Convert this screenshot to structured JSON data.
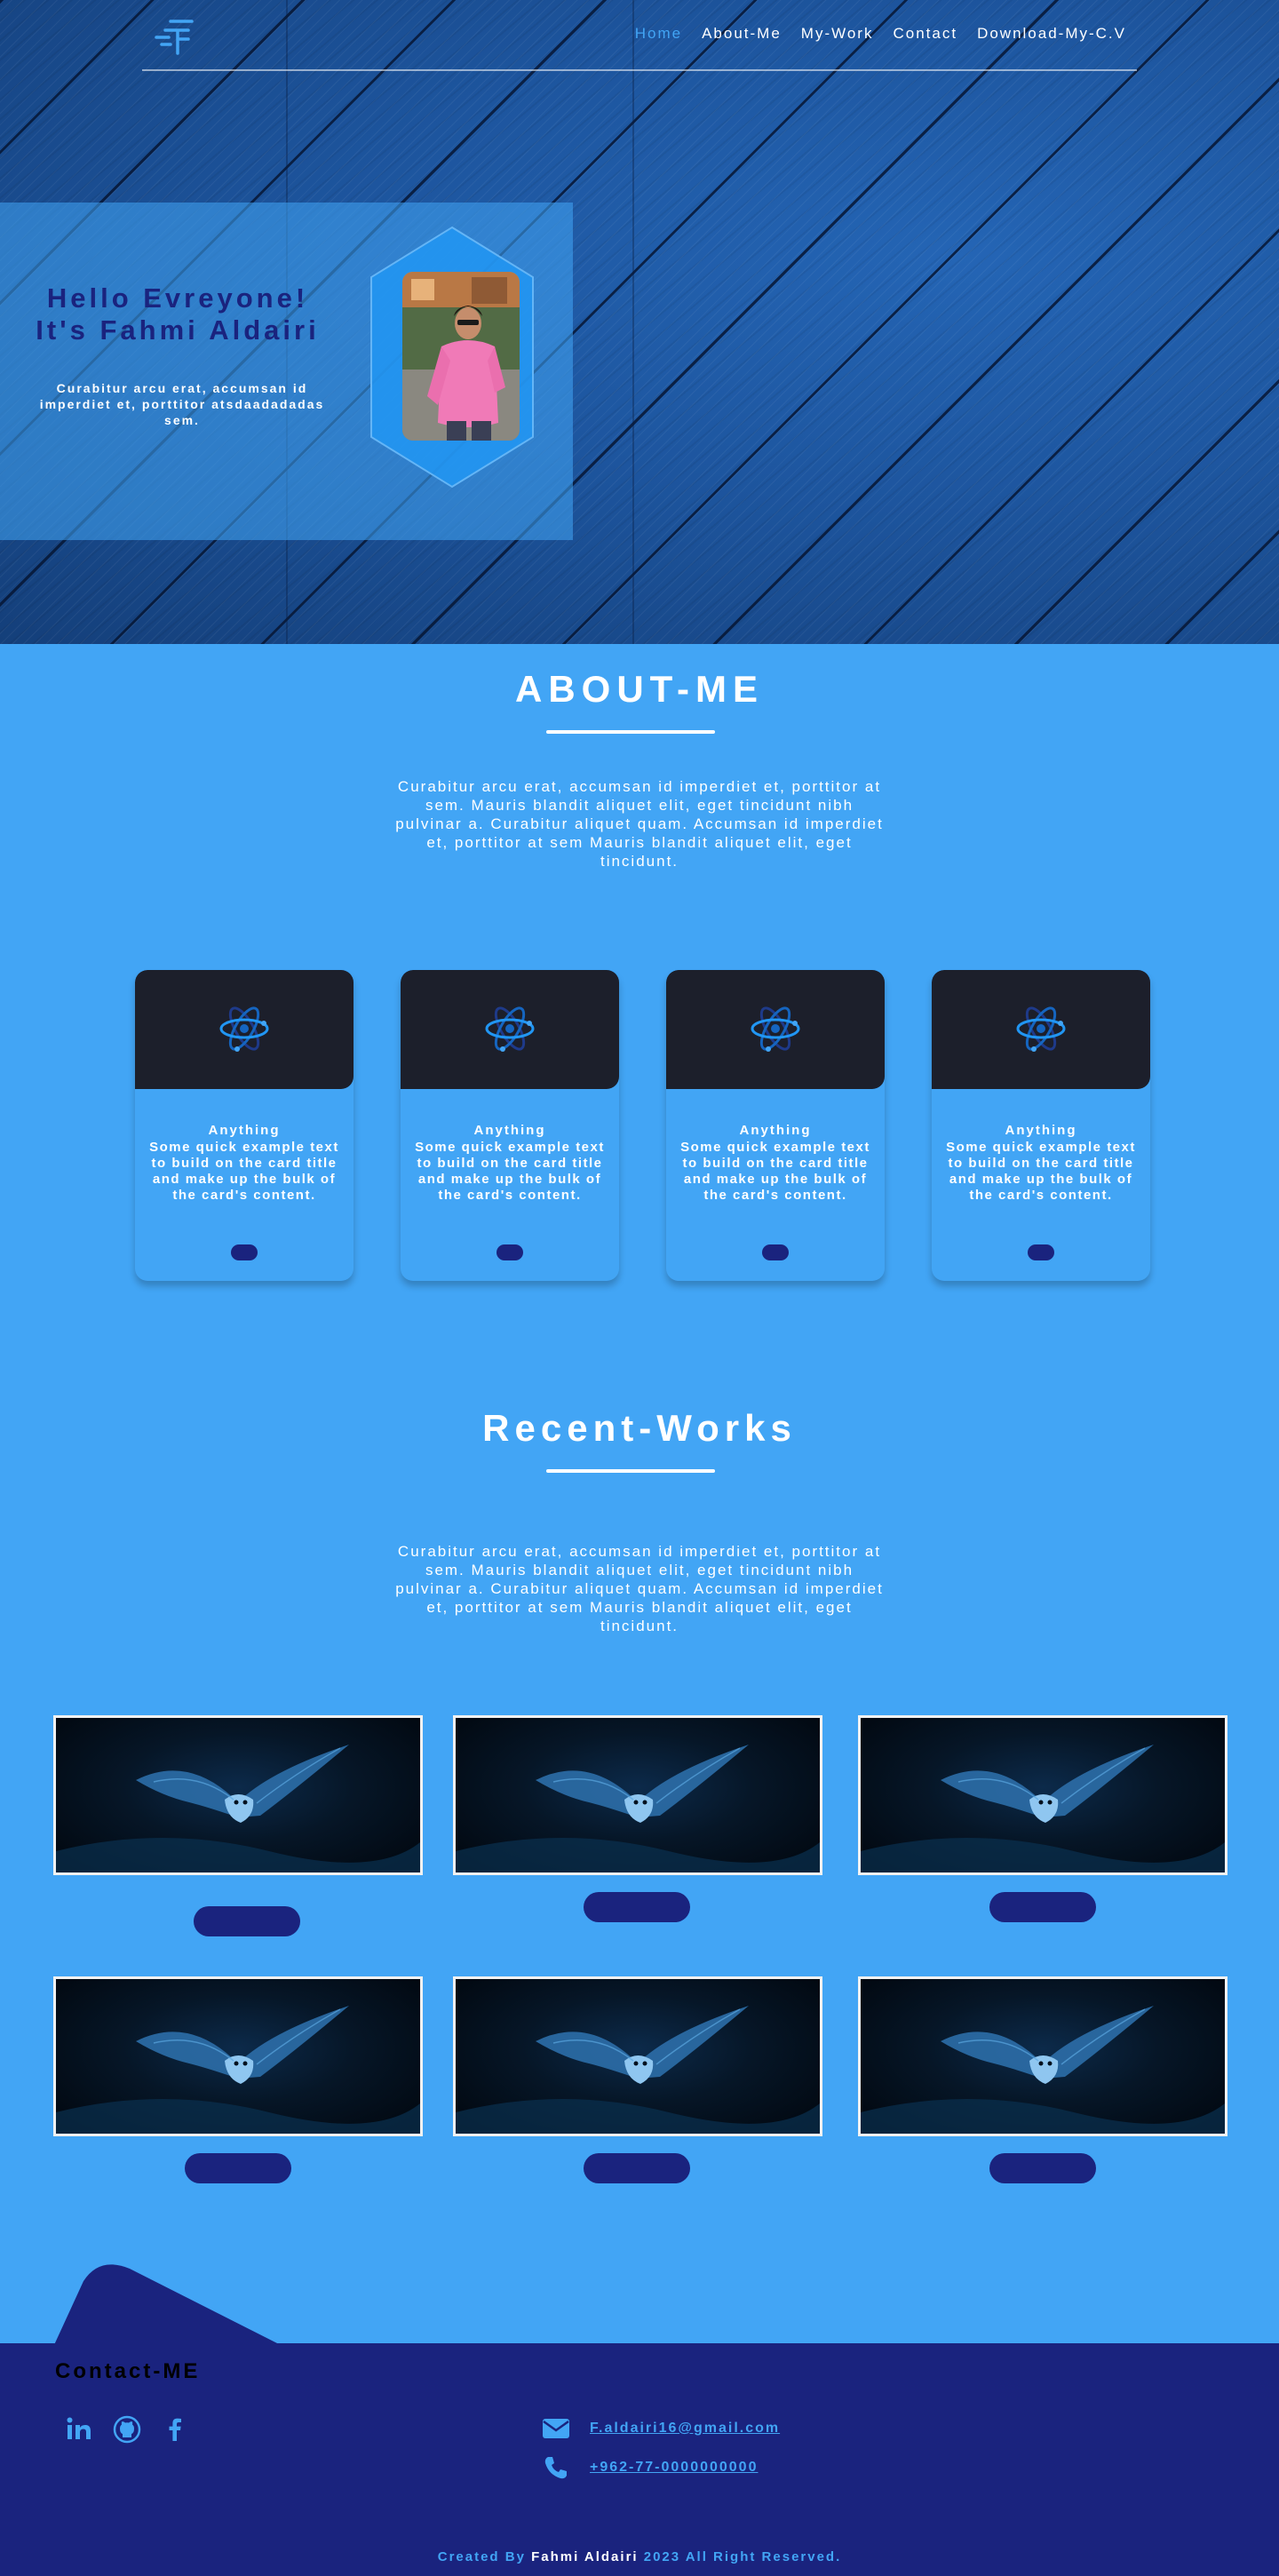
{
  "nav": {
    "logo_icon": "fahmi-logo-icon",
    "links": [
      "Home",
      "About-Me",
      "My-Work",
      "Contact",
      "Download-My-C.V"
    ],
    "active": "Home"
  },
  "hero": {
    "heading_line1": "Hello Evreyone!",
    "heading_line2": "It's Fahmi Aldairi",
    "subtitle": "Curabitur arcu erat, accumsan id imperdiet et, porttitor atsdaadadadas sem.",
    "portrait_icon": "profile-photo"
  },
  "about": {
    "title": "ABOUT-ME",
    "description": "Curabitur arcu erat, accumsan id imperdiet et, porttitor at sem. Mauris blandit aliquet elit, eget tincidunt nibh pulvinar a. Curabitur aliquet quam. Accumsan id imperdiet et, porttitor at sem Mauris blandit aliquet elit, eget tincidunt."
  },
  "cards": [
    {
      "icon": "atom-icon",
      "title": "Anything",
      "text": "Some quick example text to build on the card title and make up the bulk of the card's content."
    },
    {
      "icon": "atom-icon",
      "title": "Anything",
      "text": "Some quick example text to build on the card title and make up the bulk of the card's content."
    },
    {
      "icon": "atom-icon",
      "title": "Anything",
      "text": "Some quick example text to build on the card title and make up the bulk of the card's content."
    },
    {
      "icon": "atom-icon",
      "title": "Anything",
      "text": "Some quick example text to build on the card title and make up the bulk of the card's content."
    }
  ],
  "works": {
    "title": "Recent-Works",
    "description": "Curabitur arcu erat, accumsan id imperdiet et, porttitor at sem. Mauris blandit aliquet elit, eget tincidunt nibh pulvinar a. Curabitur aliquet quam. Accumsan id imperdiet et, porttitor at sem Mauris blandit aliquet elit, eget tincidunt.",
    "image_icon": "owl-flying-image",
    "count": 6
  },
  "footer": {
    "title": "Contact-ME",
    "social": [
      "linkedin-icon",
      "github-icon",
      "facebook-icon"
    ],
    "email": "F.aldairi16@gmail.com",
    "phone": "+962-77-0000000000",
    "copyright_prefix": "Created By ",
    "copyright_name": "Fahmi Aldairi",
    "copyright_suffix": " 2023 All Right Reserved."
  },
  "colors": {
    "primary": "#42a5f5",
    "navy": "#1a237e",
    "card_dark": "#1c1f2b"
  }
}
